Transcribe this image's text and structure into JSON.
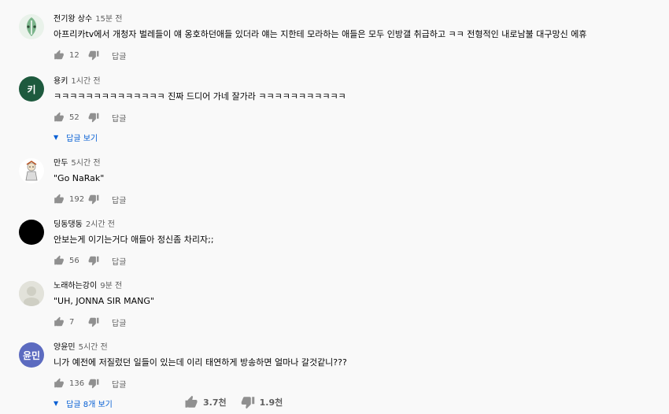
{
  "comments": [
    {
      "author": "전기왕 상수",
      "time": "15분 전",
      "text": "아프리카tv에서 개청자 벌레들이 얘 옹호하던애들 있더라 얘는 지한테 모라하는 애들은 모두 인방갤 취급하고 ㅋㅋ 전형적인 내로남불 대구망신 에휴",
      "likes": "12",
      "reply_label": "답글",
      "avatar_icon": "leaf-character-icon",
      "avatar_bg": "#e9f2ea"
    },
    {
      "author": "용키",
      "time": "1시간 전",
      "text": "ㅋㅋㅋㅋㅋㅋㅋㅋㅋㅋㅋㅋㅋㅋ 진짜 드디어 가네 잘가라 ㅋㅋㅋㅋㅋㅋㅋㅋㅋㅋㅋ",
      "likes": "52",
      "reply_label": "답글",
      "avatar_letter": "키",
      "avatar_bg": "#1e5a3e",
      "view_replies": "답글 보기"
    },
    {
      "author": "만두",
      "time": "5시간 전",
      "text": "\"Go NaRak\"",
      "likes": "192",
      "reply_label": "답글",
      "avatar_icon": "character-figure-icon",
      "avatar_bg": "#ffffff"
    },
    {
      "author": "딩동댕동",
      "time": "2시간 전",
      "text": "안보는게 이기는거다 애들아 정신좀 차리자;;",
      "likes": "56",
      "reply_label": "답글",
      "avatar_icon": "black-circle-icon",
      "avatar_bg": "#000000"
    },
    {
      "author": "노래하는강이",
      "time": "9분 전",
      "text": "\"UH, JONNA SIR MANG\"",
      "likes": "7",
      "reply_label": "답글",
      "avatar_icon": "faded-photo-icon",
      "avatar_bg": "#dcdcd6"
    },
    {
      "author": "양윤민",
      "time": "5시간 전",
      "text": "니가 예전에 저질렀던 일들이 있는데 이리 태연하게 방송하면 얼마나 갈것같니???",
      "likes": "136",
      "reply_label": "답글",
      "avatar_letter": "윤민",
      "avatar_bg": "#5c6bc0",
      "view_replies": "답글 8개 보기"
    }
  ],
  "video_stats": {
    "likes": "3.7천",
    "dislikes": "1.9천"
  }
}
